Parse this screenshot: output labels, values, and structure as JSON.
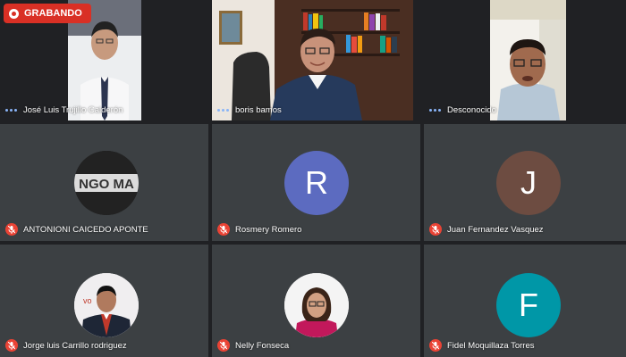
{
  "recording": {
    "label": "GRABANDO"
  },
  "participants": [
    {
      "name": "José Luis Trujillo Calderón",
      "status": "speaking-dots"
    },
    {
      "name": "boris bamos",
      "status": "speaking-dots"
    },
    {
      "name": "Desconocido",
      "status": "speaking-dots"
    },
    {
      "name": "ANTONIONI CAICEDO APONTE",
      "status": "muted",
      "avatar_text": "NGO MA"
    },
    {
      "name": "Rosmery Romero",
      "status": "muted",
      "avatar_letter": "R",
      "avatar_color": "#5c6bc0"
    },
    {
      "name": "Juan Fernandez Vasquez",
      "status": "muted",
      "avatar_letter": "J",
      "avatar_color": "#6d4c41"
    },
    {
      "name": "Jorge luis Carrillo rodriguez",
      "status": "muted"
    },
    {
      "name": "Nelly Fonseca",
      "status": "muted"
    },
    {
      "name": "Fidel Moquillaza Torres",
      "status": "muted",
      "avatar_letter": "F",
      "avatar_color": "#0097a7"
    }
  ],
  "colors": {
    "background": "#202124",
    "tile": "#3c4043",
    "muted": "#ea4335",
    "recording": "#d93025"
  }
}
